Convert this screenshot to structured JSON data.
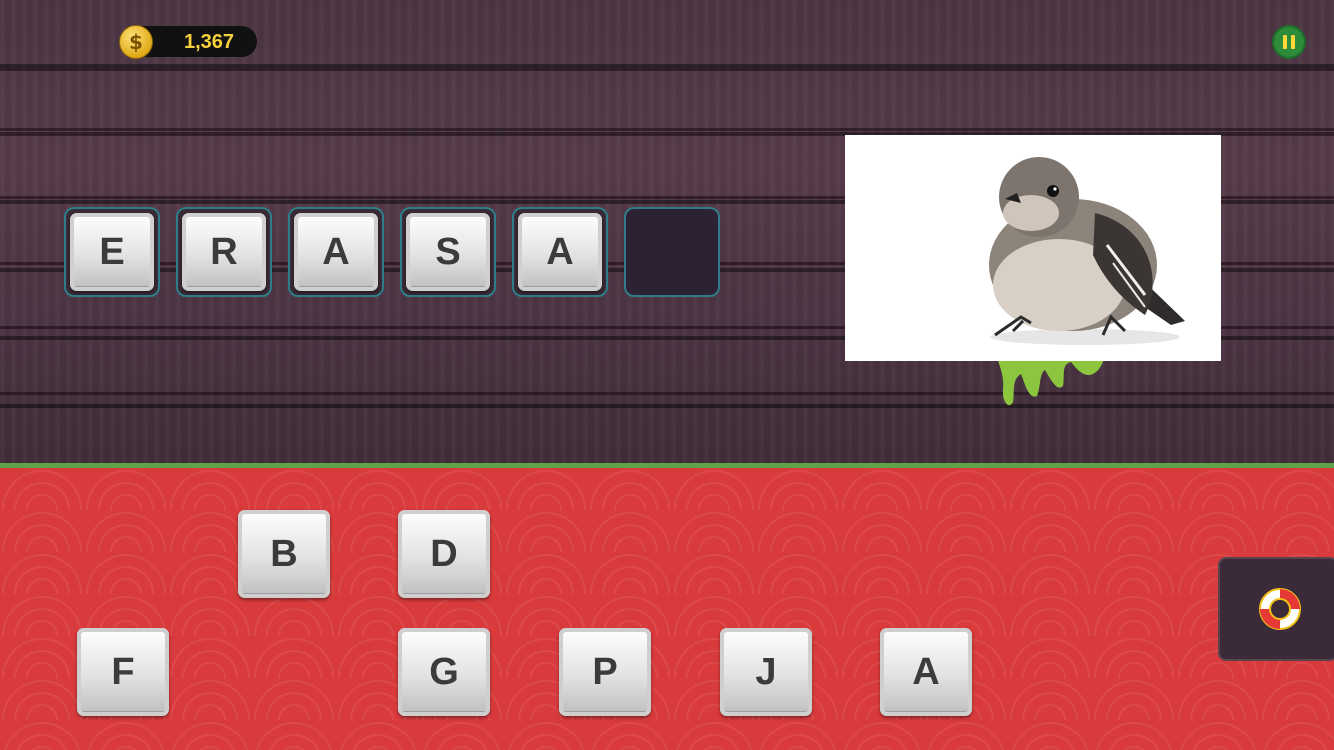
{
  "hud": {
    "coins": "1,367",
    "coin_symbol": "$"
  },
  "answer": {
    "slots": [
      "E",
      "R",
      "A",
      "S",
      "A",
      ""
    ]
  },
  "picture": {
    "subject_icon": "bird-photo"
  },
  "tray": {
    "row1": [
      "B",
      "D"
    ],
    "row2": [
      "F",
      "G",
      "P",
      "J",
      "A"
    ]
  },
  "colors": {
    "board": "#4a3441",
    "tray": "#d93b3d",
    "slot_border": "#2f7d86",
    "pause": "#2e8b3a",
    "coin_text": "#f6cf3c"
  },
  "icons": {
    "pause": "pause-icon",
    "hint": "lifebuoy-icon",
    "coin": "coin-icon"
  }
}
